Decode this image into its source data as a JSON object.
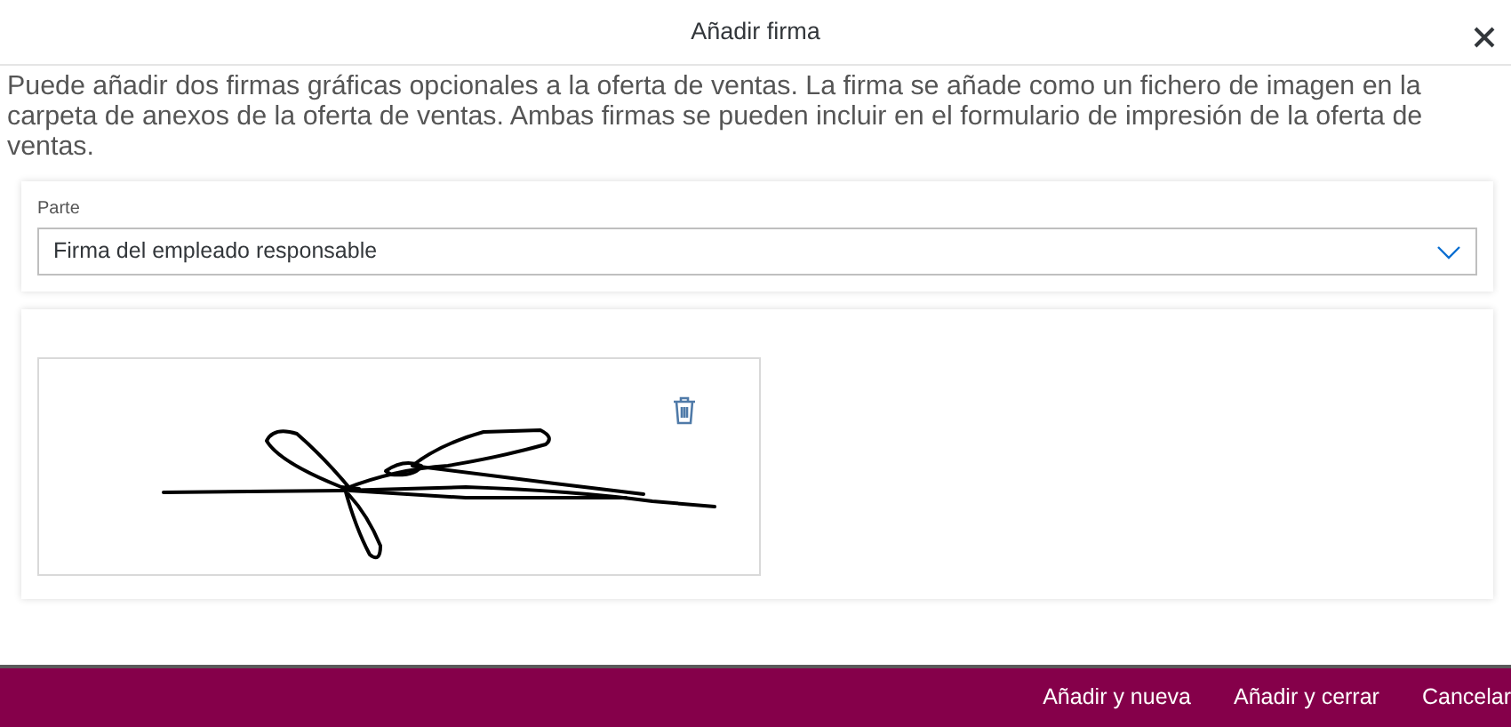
{
  "dialog": {
    "title": "Añadir firma"
  },
  "description": "Puede añadir dos firmas gráficas opcionales a la oferta de ventas. La firma se añade como un fichero de imagen en la carpeta de anexos de la oferta de ventas. Ambas firmas se pueden incluir en el formulario de impresión de la oferta de ventas.",
  "party": {
    "label": "Parte",
    "value": "Firma del empleado responsable"
  },
  "footer_buttons": [
    "Añadir y nueva",
    "Añadir y cerrar",
    "Cancelar"
  ]
}
